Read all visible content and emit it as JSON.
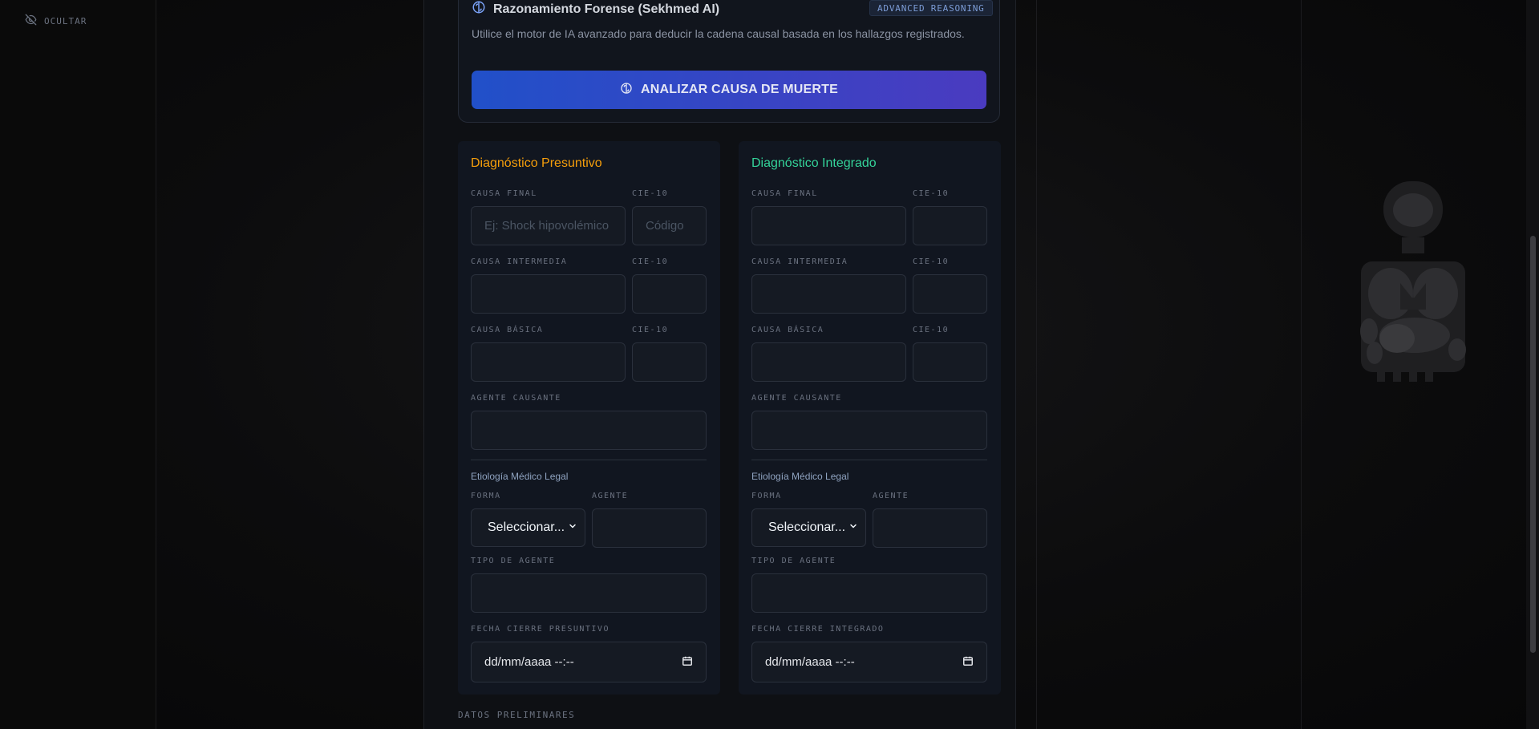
{
  "sidebar": {
    "hide_label": "OCULTAR"
  },
  "ai_panel": {
    "title": "Razonamiento Forense (Sekhmed AI)",
    "badge": "ADVANCED REASONING",
    "description": "Utilice el motor de IA avanzado para deducir la cadena causal basada en los hallazgos registrados.",
    "button_label": "ANALIZAR CAUSA DE MUERTE",
    "accent_from": "#2150c9",
    "accent_to": "#4a3bc0"
  },
  "presuntivo": {
    "title": "Diagnóstico Presuntivo",
    "title_color": "#f59e0b",
    "causa_final_label": "CAUSA FINAL",
    "causa_final_placeholder": "Ej: Shock hipovolémico",
    "causa_final_value": "",
    "cie_final_label": "CIE-10",
    "cie_final_placeholder": "Código",
    "causa_intermedia_label": "CAUSA INTERMEDIA",
    "cie_intermedia_label": "CIE-10",
    "causa_basica_label": "CAUSA BÁSICA",
    "cie_basica_label": "CIE-10",
    "agente_causante_label": "AGENTE CAUSANTE",
    "etiologia_label": "Etiología Médico Legal",
    "forma_label": "FORMA",
    "forma_value": "Seleccionar...",
    "agente_label": "AGENTE",
    "tipo_agente_label": "TIPO DE AGENTE",
    "fecha_label": "FECHA CIERRE PRESUNTIVO",
    "fecha_value": "dd/mm/aaaa --:--"
  },
  "integrado": {
    "title": "Diagnóstico Integrado",
    "title_color": "#34d399",
    "causa_final_label": "CAUSA FINAL",
    "cie_final_label": "CIE-10",
    "causa_intermedia_label": "CAUSA INTERMEDIA",
    "cie_intermedia_label": "CIE-10",
    "causa_basica_label": "CAUSA BÁSICA",
    "cie_basica_label": "CIE-10",
    "agente_causante_label": "AGENTE CAUSANTE",
    "etiologia_label": "Etiología Médico Legal",
    "forma_label": "FORMA",
    "forma_value": "Seleccionar...",
    "agente_label": "AGENTE",
    "tipo_agente_label": "TIPO DE AGENTE",
    "fecha_label": "FECHA CIERRE INTEGRADO",
    "fecha_value": "dd/mm/aaaa --:--"
  },
  "next_section": {
    "label": "DATOS PRELIMINARES"
  },
  "icons": {
    "hide": "eye-off-icon",
    "ai": "brain-icon",
    "select": "chevron-down-icon",
    "date": "calendar-icon"
  }
}
